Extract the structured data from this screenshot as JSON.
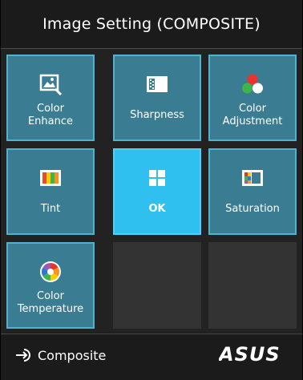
{
  "header": {
    "title": "Image Setting (COMPOSITE)"
  },
  "tiles": [
    {
      "line1": "Color",
      "line2": "Enhance",
      "icon": "image-enhance-icon"
    },
    {
      "line1": "Sharpness",
      "line2": "",
      "icon": "sharpness-icon"
    },
    {
      "line1": "Color",
      "line2": "Adjustment",
      "icon": "rgb-circles-icon"
    },
    {
      "line1": "Tint",
      "line2": "",
      "icon": "tint-icon"
    },
    {
      "line1": "OK",
      "line2": "",
      "icon": "grid-ok-icon"
    },
    {
      "line1": "Saturation",
      "line2": "",
      "icon": "saturation-icon"
    },
    {
      "line1": "Color",
      "line2": "Temperature",
      "icon": "color-wheel-icon"
    }
  ],
  "footer": {
    "source_label": "Composite",
    "brand": "ASUS"
  },
  "colors": {
    "tile": "#3a7d92",
    "tile_border": "#4fb2cf",
    "active": "#2fc0ef",
    "empty": "#333333"
  }
}
